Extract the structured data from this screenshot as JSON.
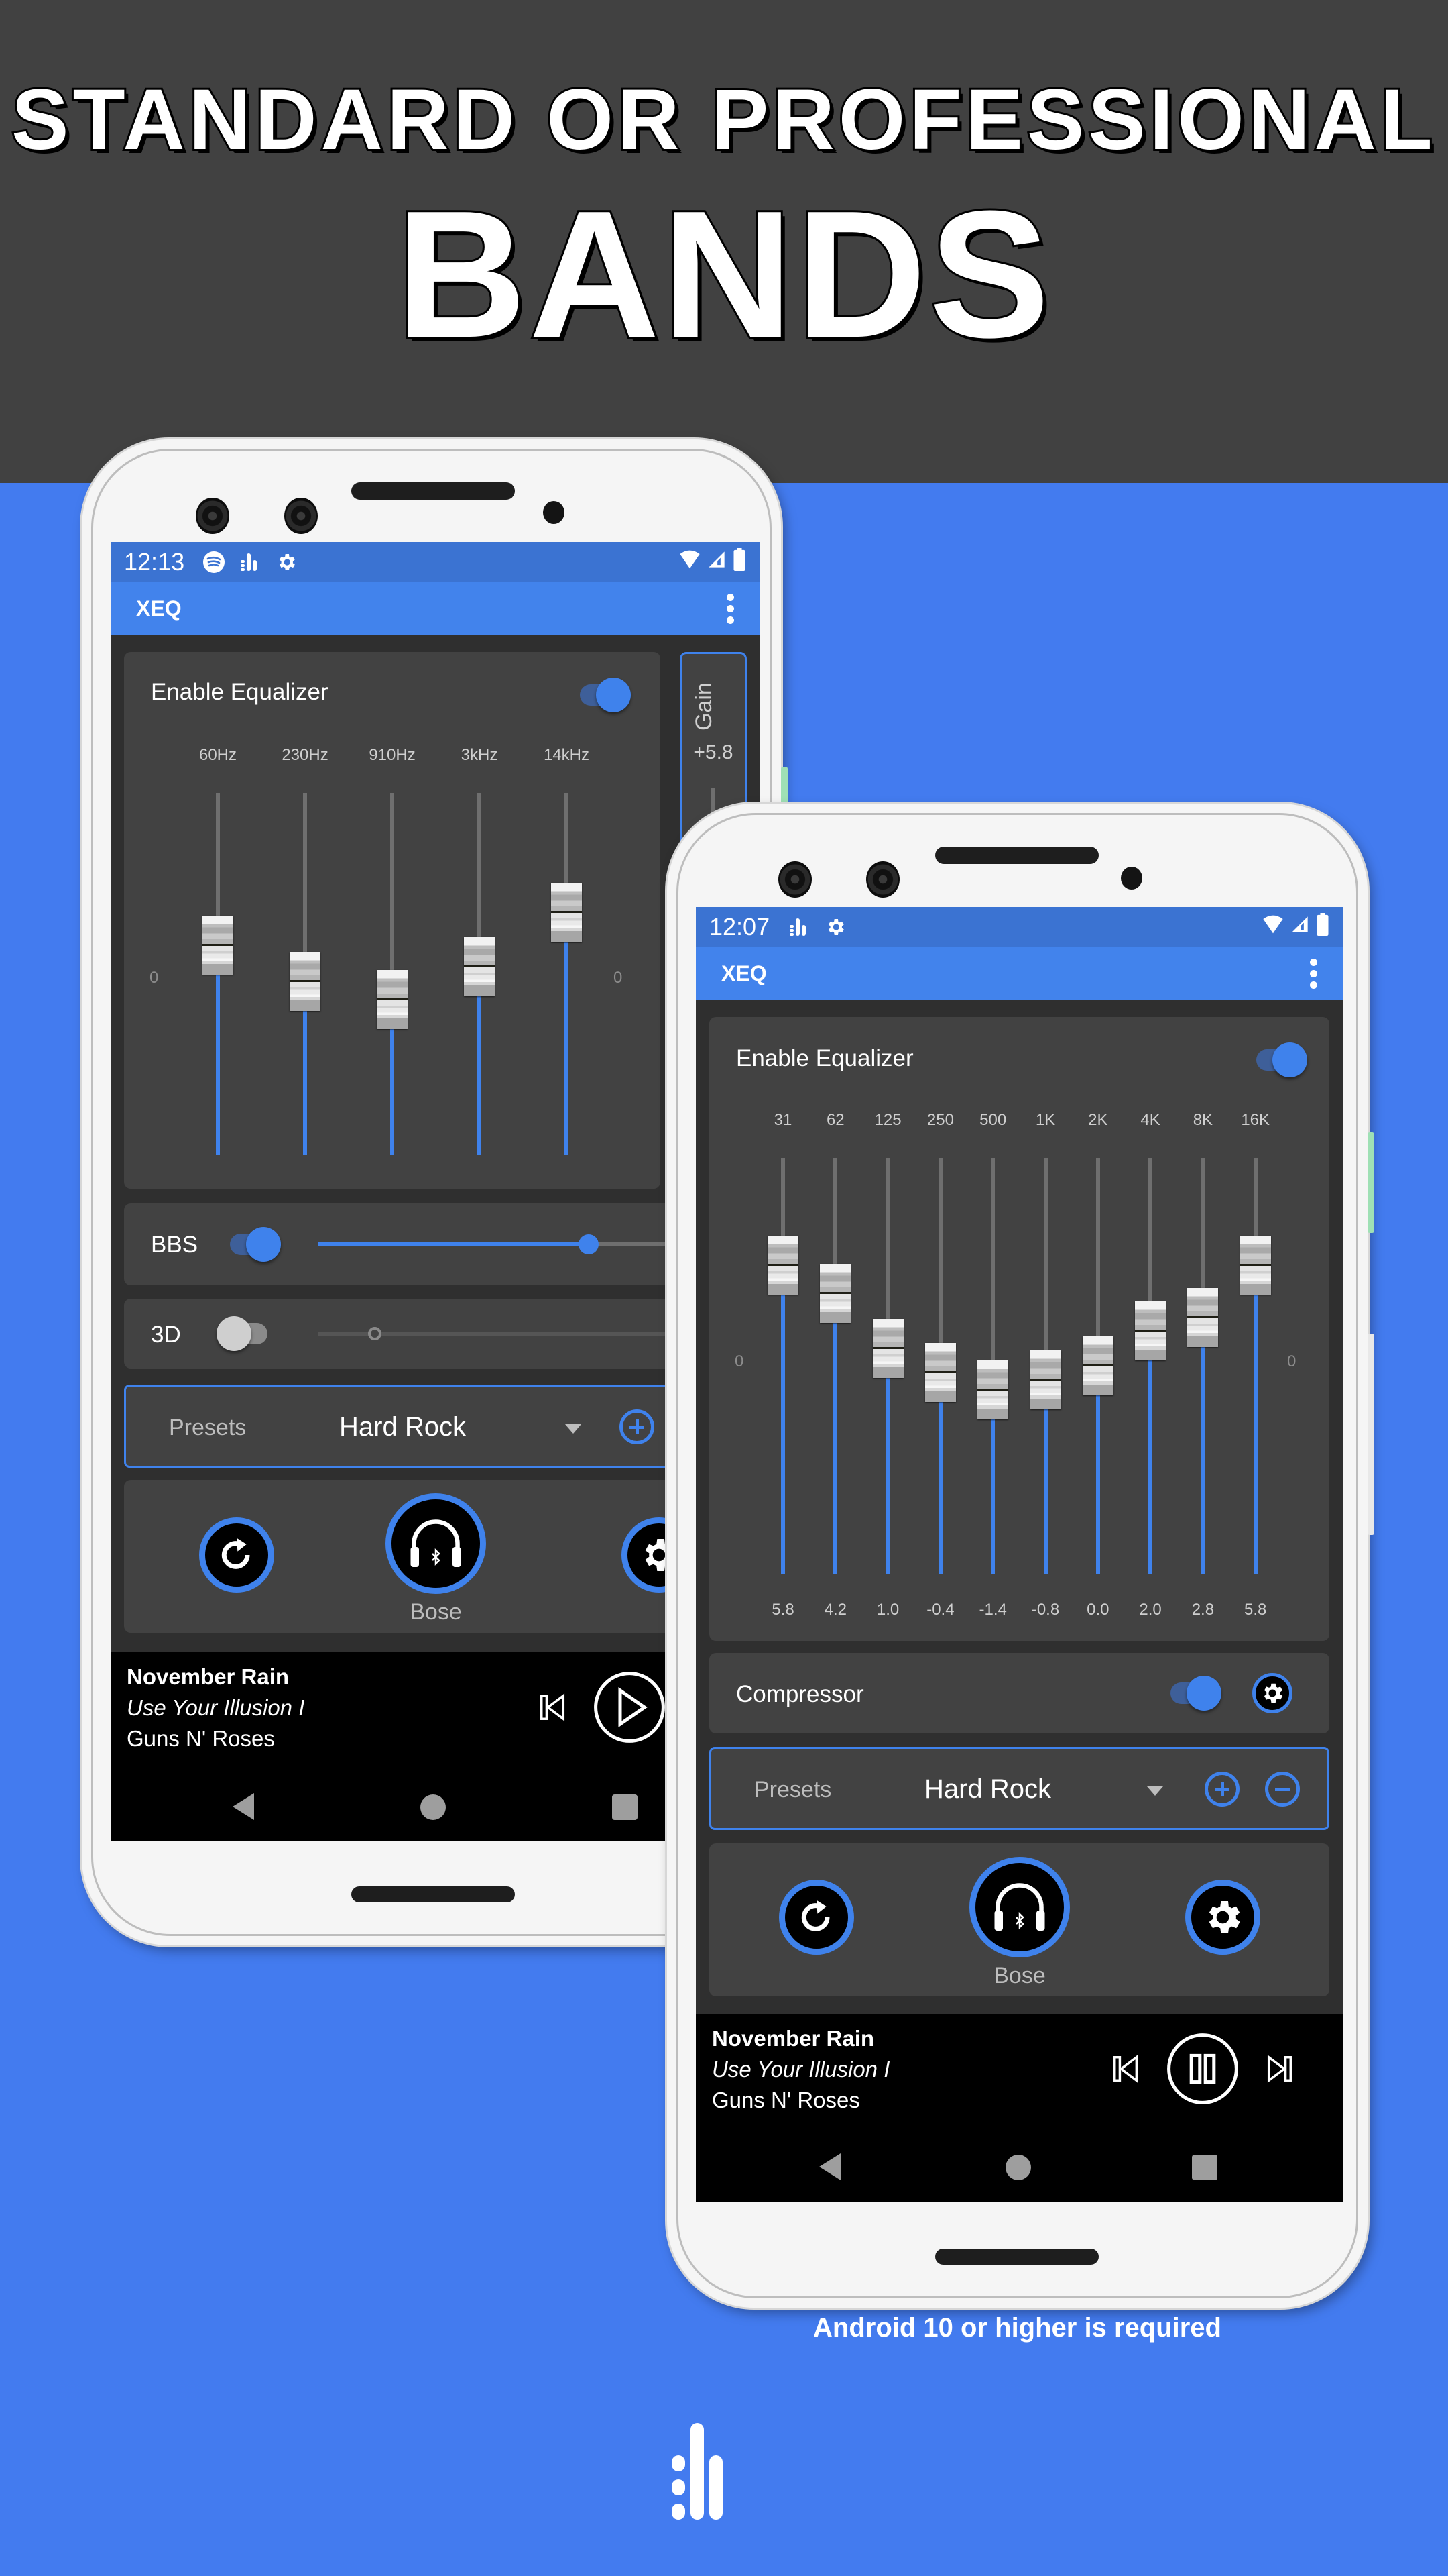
{
  "banner": {
    "line1": "STANDARD OR PROFESSIONAL",
    "line2": "BANDS",
    "footer": "Android 10 or higher is required",
    "logo_icon": "equalizer-logo-icon"
  },
  "colors": {
    "header_bg": "#414141",
    "page_bg": "#437bef",
    "accent": "#3f82ec",
    "statusbar": "#3b73d2",
    "appbar": "#4283ec",
    "card": "#424242",
    "screen_bg": "#2f2f2f"
  },
  "phone_standard": {
    "status": {
      "time": "12:13",
      "icons_left": [
        "spotify-icon",
        "equalizer-icon",
        "gear-icon"
      ],
      "icons_right": [
        "wifi-icon",
        "signal-icon",
        "battery-icon"
      ]
    },
    "app_title": "XEQ",
    "equalizer": {
      "label": "Enable Equalizer",
      "enabled": true,
      "zero_mark_left": "0",
      "zero_mark_right": "0",
      "bands": [
        {
          "label": "60Hz",
          "level": 0.58
        },
        {
          "label": "230Hz",
          "level": 0.48
        },
        {
          "label": "910Hz",
          "level": 0.43
        },
        {
          "label": "3kHz",
          "level": 0.52
        },
        {
          "label": "14kHz",
          "level": 0.67
        }
      ]
    },
    "gain": {
      "label": "Gain",
      "value": "+5.8"
    },
    "bbs": {
      "label": "BBS",
      "enabled": true,
      "level": 0.72
    },
    "three_d": {
      "label": "3D",
      "enabled": false,
      "level": 0.15
    },
    "presets": {
      "label": "Presets",
      "selected": "Hard Rock",
      "add_icon": "add-circle-icon"
    },
    "actions": {
      "reset_icon": "reset-icon",
      "device_icon": "bluetooth-headphones-icon",
      "device_name": "Bose",
      "settings_icon": "gear-icon"
    },
    "now_playing": {
      "title": "November Rain",
      "album": "Use Your Illusion I",
      "artist": "Guns N' Roses",
      "controls": [
        "skip-previous-icon",
        "play-icon"
      ]
    },
    "navbar": [
      "back-icon",
      "home-icon",
      "recents-icon"
    ]
  },
  "phone_pro": {
    "status": {
      "time": "12:07",
      "icons_left": [
        "equalizer-icon",
        "gear-icon"
      ],
      "icons_right": [
        "wifi-icon",
        "signal-icon",
        "battery-icon"
      ]
    },
    "app_title": "XEQ",
    "equalizer": {
      "label": "Enable Equalizer",
      "enabled": true,
      "zero_mark_left": "0",
      "zero_mark_right": "0",
      "range_db": [
        -12,
        12
      ],
      "bands": [
        {
          "label": "31",
          "value": "5.8",
          "db": 5.8
        },
        {
          "label": "62",
          "value": "4.2",
          "db": 4.2
        },
        {
          "label": "125",
          "value": "1.0",
          "db": 1.0
        },
        {
          "label": "250",
          "value": "-0.4",
          "db": -0.4
        },
        {
          "label": "500",
          "value": "-1.4",
          "db": -1.4
        },
        {
          "label": "1K",
          "value": "-0.8",
          "db": -0.8
        },
        {
          "label": "2K",
          "value": "0.0",
          "db": 0.0
        },
        {
          "label": "4K",
          "value": "2.0",
          "db": 2.0
        },
        {
          "label": "8K",
          "value": "2.8",
          "db": 2.8
        },
        {
          "label": "16K",
          "value": "5.8",
          "db": 5.8
        }
      ]
    },
    "compressor": {
      "label": "Compressor",
      "enabled": true,
      "settings_icon": "gear-icon"
    },
    "presets": {
      "label": "Presets",
      "selected": "Hard Rock",
      "add_icon": "add-circle-icon",
      "remove_icon": "remove-circle-icon"
    },
    "actions": {
      "reset_icon": "reset-icon",
      "device_icon": "bluetooth-headphones-icon",
      "device_name": "Bose",
      "settings_icon": "gear-icon"
    },
    "now_playing": {
      "title": "November Rain",
      "album": "Use Your Illusion I",
      "artist": "Guns N' Roses",
      "controls": [
        "skip-previous-icon",
        "pause-icon",
        "skip-next-icon"
      ]
    },
    "navbar": [
      "back-icon",
      "home-icon",
      "recents-icon"
    ]
  }
}
